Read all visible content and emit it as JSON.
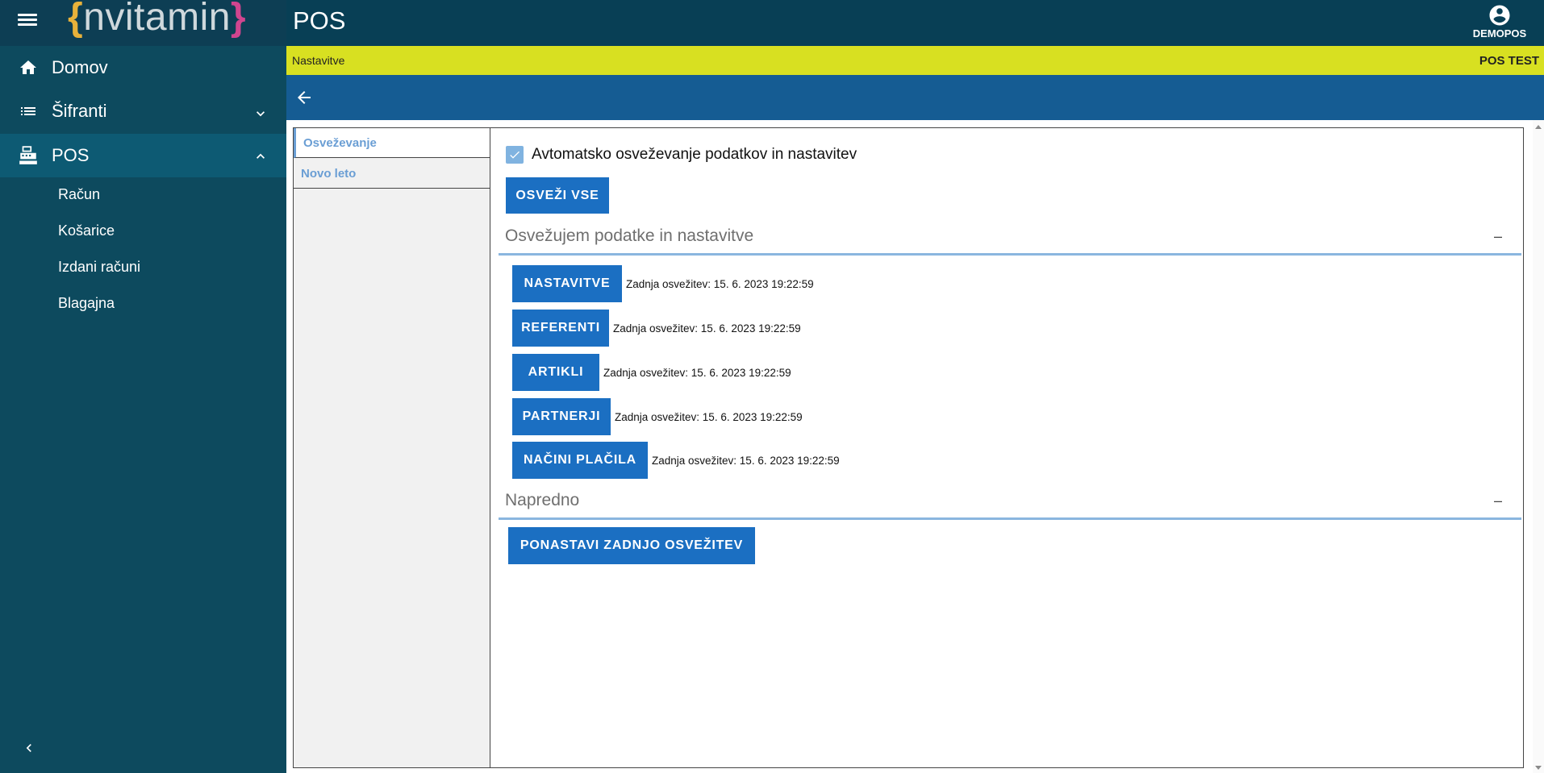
{
  "app": {
    "logo_left_bracket": "{",
    "logo_text": "nvitamin",
    "logo_right_bracket": "}",
    "page_title": "POS",
    "user_name": "DEMOPOS"
  },
  "sidebar": {
    "items": [
      {
        "label": "Domov",
        "icon": "home-icon"
      },
      {
        "label": "Šifranti",
        "icon": "list-icon",
        "expanded": false
      },
      {
        "label": "POS",
        "icon": "cash-register-icon",
        "expanded": true
      }
    ],
    "subitems": [
      {
        "label": "Račun"
      },
      {
        "label": "Košarice"
      },
      {
        "label": "Izdani računi"
      },
      {
        "label": "Blagajna"
      }
    ]
  },
  "breadcrumb": {
    "path": "Nastavitve",
    "environment": "POS TEST"
  },
  "tabs": [
    {
      "label": "Osveževanje",
      "selected": true
    },
    {
      "label": "Novo leto",
      "selected": false
    }
  ],
  "refresh": {
    "auto_checkbox_label": "Avtomatsko osveževanje podatkov in nastavitev",
    "auto_checked": true,
    "refresh_all_label": "OSVEŽI VSE",
    "section_title": "Osvežujem podatke in nastavitve",
    "section_toggle": "–",
    "items": [
      {
        "label": "NASTAVITVE",
        "timestamp": "Zadnja osvežitev: 15. 6. 2023 19:22:59"
      },
      {
        "label": "REFERENTI",
        "timestamp": "Zadnja osvežitev: 15. 6. 2023 19:22:59"
      },
      {
        "label": "ARTIKLI",
        "timestamp": "Zadnja osvežitev: 15. 6. 2023 19:22:59"
      },
      {
        "label": "PARTNERJI",
        "timestamp": "Zadnja osvežitev: 15. 6. 2023 19:22:59"
      },
      {
        "label": "NAČINI PLAČILA",
        "timestamp": "Zadnja osvežitev: 15. 6. 2023 19:22:59"
      }
    ]
  },
  "advanced": {
    "section_title": "Napredno",
    "section_toggle": "–",
    "reset_label": "PONASTAVI ZADNJO OSVEŽITEV"
  },
  "colors": {
    "sidebar_bg": "#0d4a5e",
    "topbar_bg": "#083f55",
    "breadcrumb_bg": "#d8e021",
    "actionbar_bg": "#155c93",
    "button_bg": "#1b6fc2",
    "tab_text": "#6a9ed4"
  }
}
